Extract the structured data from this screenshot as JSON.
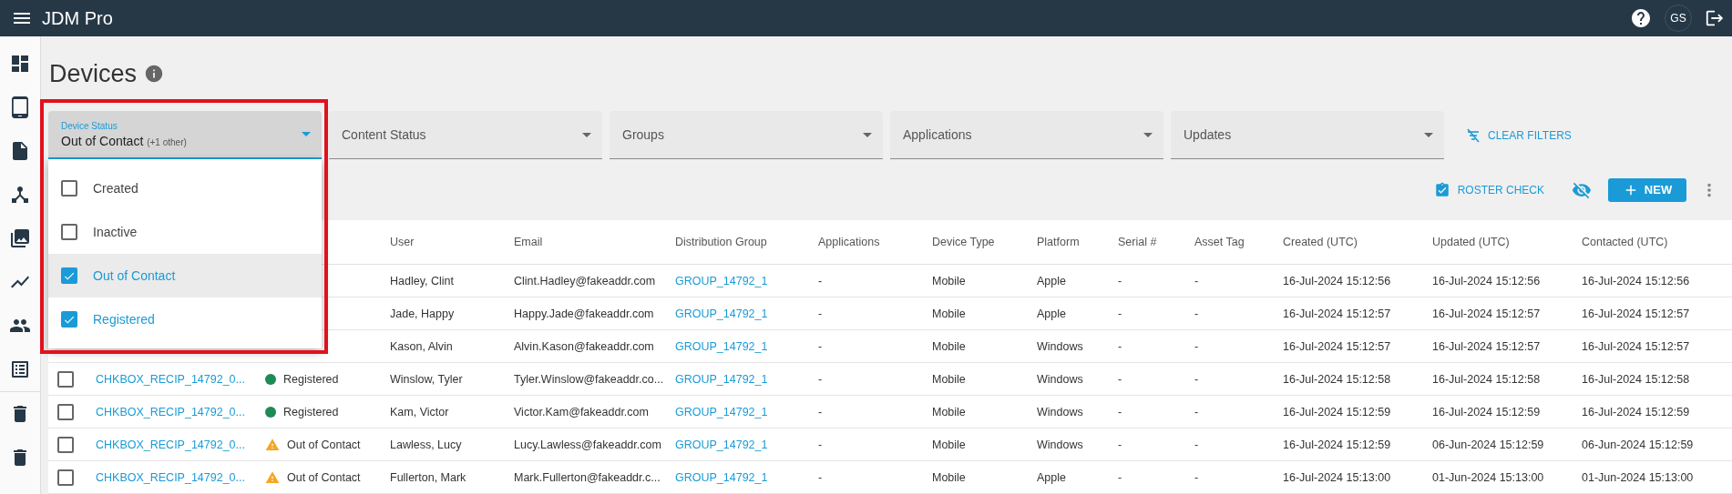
{
  "app": {
    "title": "JDM Pro",
    "avatar": "GS"
  },
  "page": {
    "title": "Devices"
  },
  "filters": [
    {
      "label": "Device Status",
      "value": "Out of Contact",
      "extra": "(+1 other)",
      "expanded": true,
      "options": [
        {
          "label": "Created",
          "checked": false,
          "highlighted": false
        },
        {
          "label": "Inactive",
          "checked": false,
          "highlighted": false
        },
        {
          "label": "Out of Contact",
          "checked": true,
          "highlighted": true
        },
        {
          "label": "Registered",
          "checked": true,
          "highlighted": false
        }
      ]
    },
    {
      "label": "Content Status",
      "expanded": false
    },
    {
      "label": "Groups",
      "expanded": false
    },
    {
      "label": "Applications",
      "expanded": false
    },
    {
      "label": "Updates",
      "expanded": false
    }
  ],
  "clear_filters": "CLEAR FILTERS",
  "actions": {
    "roster_check": "ROSTER CHECK",
    "new": "NEW"
  },
  "table": {
    "columns": [
      "User",
      "Email",
      "Distribution Group",
      "Applications",
      "Device Type",
      "Platform",
      "Serial #",
      "Asset Tag",
      "Created (UTC)",
      "Updated (UTC)",
      "Contacted (UTC)"
    ],
    "rows": [
      {
        "cells": [
          "Hadley, Clint",
          "Clint.Hadley@fakeaddr.com",
          "GROUP_14792_1",
          "-",
          "Mobile",
          "Apple",
          "-",
          "-",
          "16-Jul-2024 15:12:56",
          "16-Jul-2024 15:12:56",
          "16-Jul-2024 15:12:56"
        ]
      },
      {
        "cells": [
          "Jade, Happy",
          "Happy.Jade@fakeaddr.com",
          "GROUP_14792_1",
          "-",
          "Mobile",
          "Apple",
          "-",
          "-",
          "16-Jul-2024 15:12:57",
          "16-Jul-2024 15:12:57",
          "16-Jul-2024 15:12:57"
        ]
      },
      {
        "cells": [
          "Kason, Alvin",
          "Alvin.Kason@fakeaddr.com",
          "GROUP_14792_1",
          "-",
          "Mobile",
          "Windows",
          "-",
          "-",
          "16-Jul-2024 15:12:57",
          "16-Jul-2024 15:12:57",
          "16-Jul-2024 15:12:57"
        ]
      },
      {
        "checked": false,
        "name": "CHKBOX_RECIP_14792_0...",
        "status": {
          "kind": "registered",
          "text": "Registered"
        },
        "cells": [
          "Winslow, Tyler",
          "Tyler.Winslow@fakeaddr.co...",
          "GROUP_14792_1",
          "-",
          "Mobile",
          "Windows",
          "-",
          "-",
          "16-Jul-2024 15:12:58",
          "16-Jul-2024 15:12:58",
          "16-Jul-2024 15:12:58"
        ]
      },
      {
        "checked": false,
        "name": "CHKBOX_RECIP_14792_0...",
        "status": {
          "kind": "registered",
          "text": "Registered"
        },
        "cells": [
          "Kam, Victor",
          "Victor.Kam@fakeaddr.com",
          "GROUP_14792_1",
          "-",
          "Mobile",
          "Windows",
          "-",
          "-",
          "16-Jul-2024 15:12:59",
          "16-Jul-2024 15:12:59",
          "16-Jul-2024 15:12:59"
        ]
      },
      {
        "checked": false,
        "name": "CHKBOX_RECIP_14792_0...",
        "status": {
          "kind": "warning",
          "text": "Out of Contact"
        },
        "cells": [
          "Lawless, Lucy",
          "Lucy.Lawless@fakeaddr.com",
          "GROUP_14792_1",
          "-",
          "Mobile",
          "Windows",
          "-",
          "-",
          "16-Jul-2024 15:12:59",
          "06-Jun-2024 15:12:59",
          "06-Jun-2024 15:12:59"
        ]
      },
      {
        "checked": false,
        "name": "CHKBOX_RECIP_14792_0...",
        "status": {
          "kind": "warning",
          "text": "Out of Contact"
        },
        "cells": [
          "Fullerton, Mark",
          "Mark.Fullerton@fakeaddr.c...",
          "GROUP_14792_1",
          "-",
          "Mobile",
          "Apple",
          "-",
          "-",
          "16-Jul-2024 15:13:00",
          "01-Jun-2024 15:13:00",
          "01-Jun-2024 15:13:00"
        ]
      }
    ]
  }
}
